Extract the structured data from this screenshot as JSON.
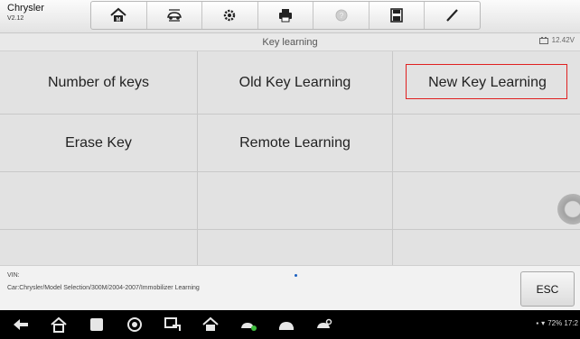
{
  "app": {
    "name": "Chrysler",
    "version": "V2.12"
  },
  "toolbar": {
    "buttons": [
      {
        "icon": "home-icon"
      },
      {
        "icon": "vehicle-swap-icon"
      },
      {
        "icon": "settings-icon"
      },
      {
        "icon": "print-icon"
      },
      {
        "icon": "help-icon"
      },
      {
        "icon": "save-icon"
      },
      {
        "icon": "edit-icon"
      }
    ]
  },
  "titlebar": {
    "title": "Key learning",
    "battery_voltage": "12.42V"
  },
  "menu": {
    "items": [
      "Number of keys",
      "Old Key Learning",
      "New Key Learning",
      "Erase Key",
      "Remote Learning",
      "",
      "",
      "",
      "",
      "",
      "",
      ""
    ],
    "selected": "New Key Learning"
  },
  "status": {
    "vin_label": "VIN:",
    "car_path": "Car:Chrysler/Model Selection/300M/2004-2007/Immobilizer Learning",
    "esc_label": "ESC"
  },
  "system_bar": {
    "status_text": "72% 17:2"
  },
  "colors": {
    "selection_border": "#e02020",
    "navbar_bg": "#000000"
  }
}
